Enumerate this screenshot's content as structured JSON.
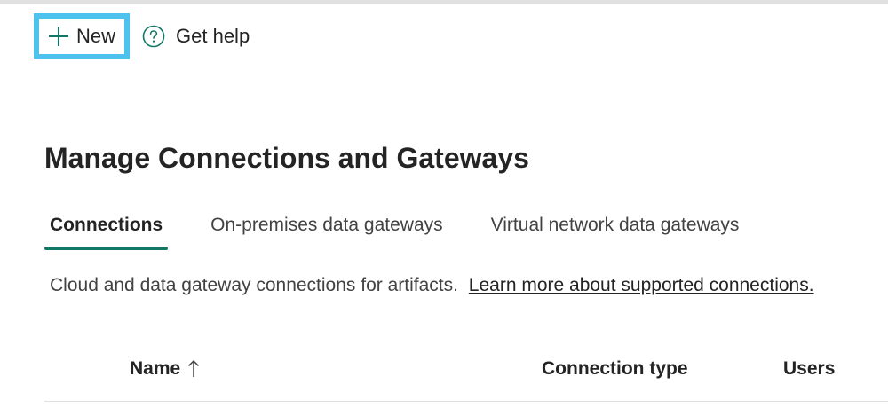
{
  "toolbar": {
    "new_label": "New",
    "help_label": "Get help"
  },
  "page": {
    "title": "Manage Connections and Gateways"
  },
  "tabs": [
    {
      "label": "Connections",
      "active": true
    },
    {
      "label": "On-premises data gateways",
      "active": false
    },
    {
      "label": "Virtual network data gateways",
      "active": false
    }
  ],
  "description": {
    "text": "Cloud and data gateway connections for artifacts.",
    "link": "Learn more about supported connections."
  },
  "table": {
    "columns": [
      {
        "label": "Name",
        "sort": "ascending"
      },
      {
        "label": "Connection type"
      },
      {
        "label": "Users"
      }
    ]
  },
  "colors": {
    "accent": "#117865",
    "highlight": "#4cc2ec"
  }
}
